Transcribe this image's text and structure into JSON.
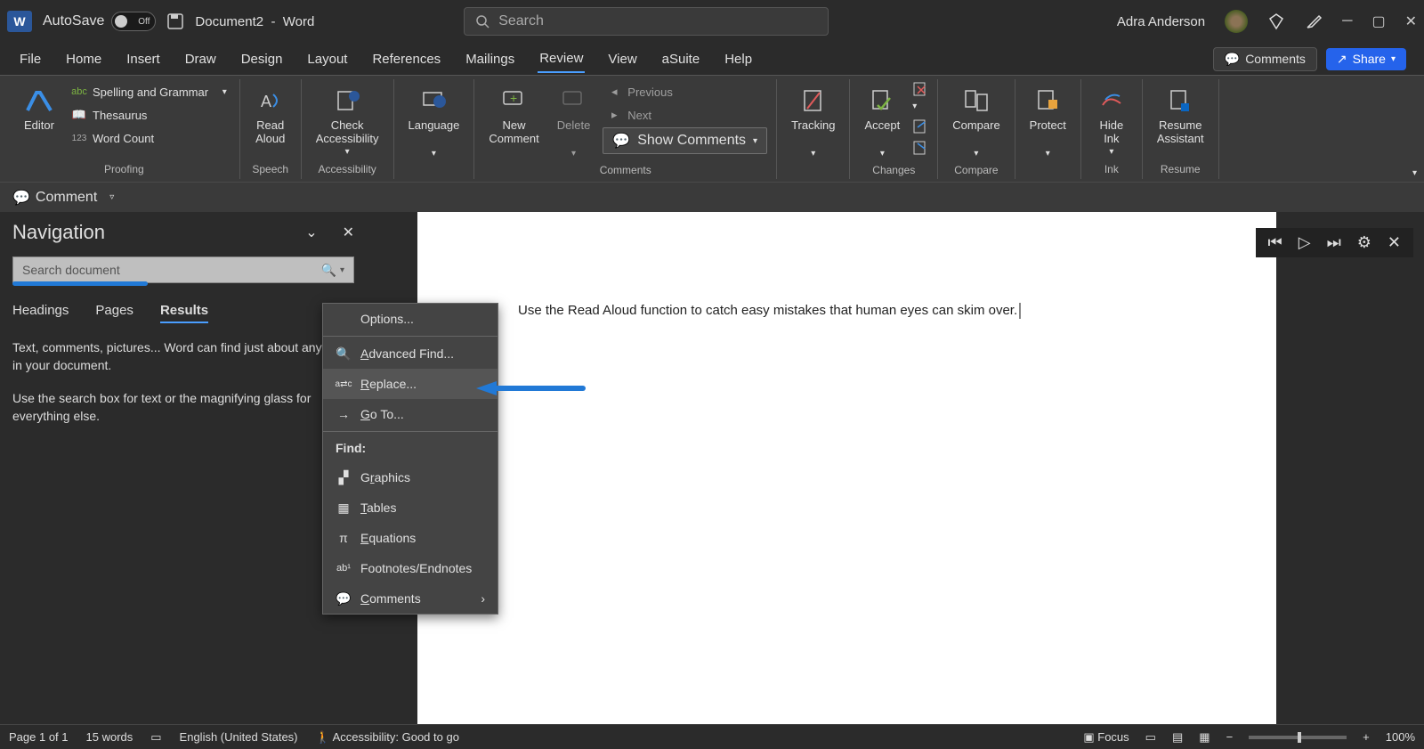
{
  "titlebar": {
    "autosave_label": "AutoSave",
    "autosave_state": "Off",
    "doc_name": "Document2",
    "separator": "-",
    "app_name": "Word",
    "search_placeholder": "Search",
    "user_name": "Adra Anderson"
  },
  "tabs": {
    "file": "File",
    "home": "Home",
    "insert": "Insert",
    "draw": "Draw",
    "design": "Design",
    "layout": "Layout",
    "references": "References",
    "mailings": "Mailings",
    "review": "Review",
    "view": "View",
    "asuite": "aSuite",
    "help": "Help",
    "comments_btn": "Comments",
    "share_btn": "Share"
  },
  "ribbon": {
    "proofing": {
      "editor": "Editor",
      "spelling": "Spelling and Grammar",
      "thesaurus": "Thesaurus",
      "word_count": "Word Count",
      "label": "Proofing"
    },
    "speech": {
      "read_aloud": "Read\nAloud",
      "label": "Speech"
    },
    "accessibility": {
      "check": "Check\nAccessibility",
      "label": "Accessibility"
    },
    "language": {
      "btn": "Language"
    },
    "comments": {
      "new": "New\nComment",
      "delete": "Delete",
      "previous": "Previous",
      "next": "Next",
      "show": "Show Comments",
      "label": "Comments"
    },
    "tracking": {
      "btn": "Tracking"
    },
    "changes": {
      "accept": "Accept",
      "label": "Changes"
    },
    "compare": {
      "btn": "Compare",
      "label": "Compare"
    },
    "protect": {
      "btn": "Protect"
    },
    "ink": {
      "hide": "Hide\nInk",
      "label": "Ink"
    },
    "resume": {
      "btn": "Resume\nAssistant",
      "label": "Resume"
    }
  },
  "qat": {
    "comment": "Comment"
  },
  "nav": {
    "title": "Navigation",
    "search_placeholder": "Search document",
    "tabs": {
      "headings": "Headings",
      "pages": "Pages",
      "results": "Results"
    },
    "text1": "Text, comments, pictures... Word can find just about anything in your document.",
    "text2": "Use the search box for text or the magnifying glass for everything else."
  },
  "ctx": {
    "options": "Options...",
    "advanced_find": "Advanced Find...",
    "replace": "Replace...",
    "goto": "Go To...",
    "find_header": "Find:",
    "graphics": "Graphics",
    "tables": "Tables",
    "equations": "Equations",
    "footnotes": "Footnotes/Endnotes",
    "comments": "Comments"
  },
  "doc": {
    "text": "Use the Read Aloud function to catch easy mistakes that human eyes can skim over."
  },
  "status": {
    "page": "Page 1 of 1",
    "words": "15 words",
    "lang": "English (United States)",
    "accessibility": "Accessibility: Good to go",
    "focus": "Focus",
    "zoom": "100%"
  }
}
